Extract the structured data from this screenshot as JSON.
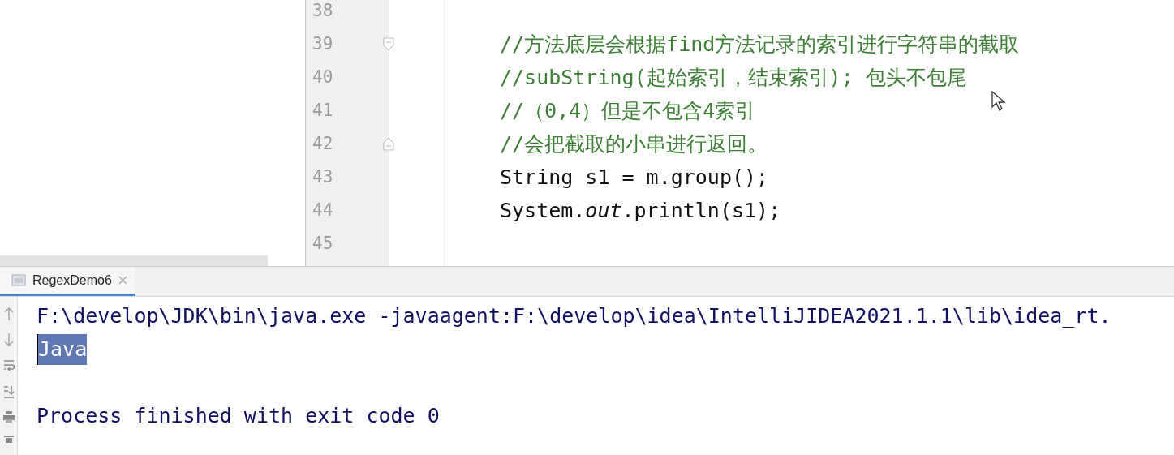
{
  "editor": {
    "lines": [
      {
        "number": "38"
      },
      {
        "number": "39",
        "fold_open": true,
        "kind": "comment",
        "text": "//方法底层会根据find方法记录的索引进行字符串的截取"
      },
      {
        "number": "40",
        "kind": "comment",
        "text": "//subString(起始索引，结束索引); 包头不包尾"
      },
      {
        "number": "41",
        "kind": "comment",
        "text": "//（0,4）但是不包含4索引"
      },
      {
        "number": "42",
        "fold_close": true,
        "kind": "comment",
        "text": "//会把截取的小串进行返回。"
      },
      {
        "number": "43",
        "kind": "code",
        "text": "String s1 = m.group();"
      },
      {
        "number": "44",
        "kind": "code",
        "text": "System.*out*.println(s1);"
      },
      {
        "number": "45"
      }
    ]
  },
  "run_panel": {
    "tabs": [
      {
        "label": "RegexDemo6",
        "selected": true
      }
    ],
    "console": [
      {
        "kind": "command",
        "text": "F:\\develop\\JDK\\bin\\java.exe -javaagent:F:\\develop\\idea\\IntelliJIDEA2021.1.1\\lib\\idea_rt."
      },
      {
        "kind": "output",
        "text": "Java",
        "selected": true
      },
      {
        "kind": "blank"
      },
      {
        "kind": "output",
        "text": "Process finished with exit code 0",
        "selected": false
      }
    ]
  }
}
